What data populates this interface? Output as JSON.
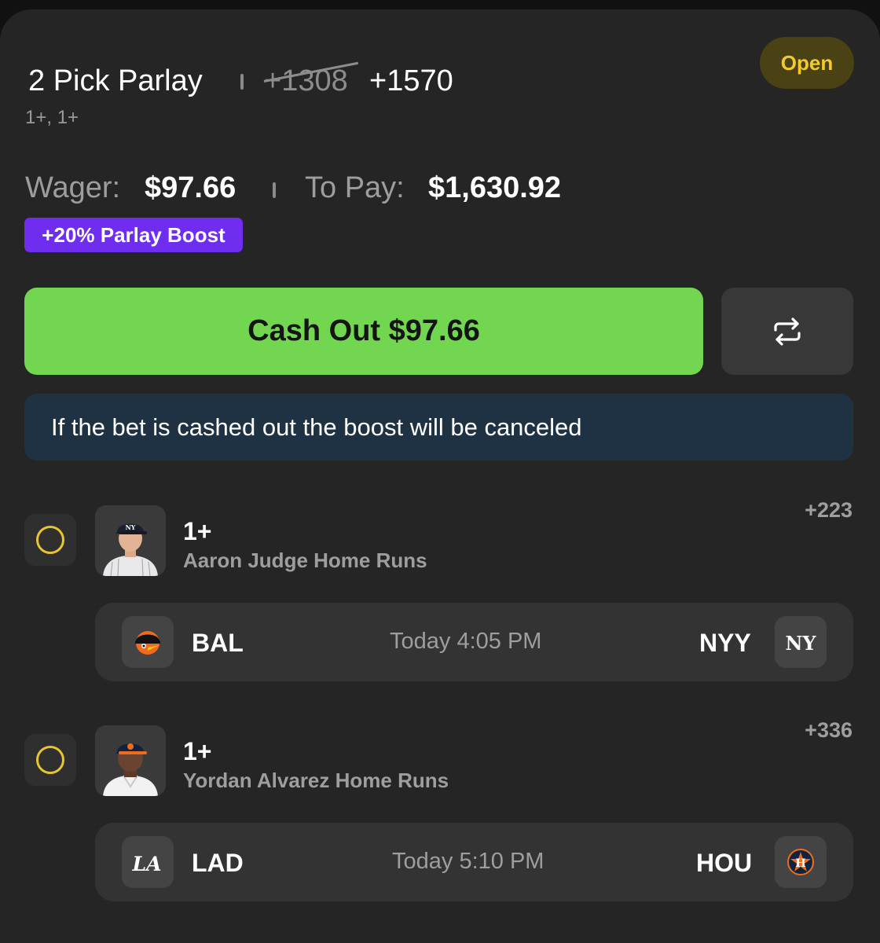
{
  "bet": {
    "title": "2 Pick Parlay",
    "original_odds": "+1308",
    "boosted_odds": "+1570",
    "subtitle": "1+, 1+",
    "status": "Open",
    "wager_label": "Wager:",
    "wager_value": "$97.66",
    "to_pay_label": "To Pay:",
    "to_pay_value": "$1,630.92",
    "boost_label": "+20% Parlay Boost",
    "cashout_label": "Cash Out $97.66",
    "notice": "If the bet is cashed out the boost will be canceled"
  },
  "picks": [
    {
      "line": "1+",
      "market": "Aaron Judge Home Runs",
      "odds": "+223",
      "headshot_icon": "aaron-judge-headshot",
      "game": {
        "away": "BAL",
        "home": "NYY",
        "time": "Today 4:05 PM",
        "away_logo_icon": "orioles-logo",
        "home_logo_icon": "yankees-logo"
      }
    },
    {
      "line": "1+",
      "market": "Yordan Alvarez Home Runs",
      "odds": "+336",
      "headshot_icon": "yordan-alvarez-headshot",
      "game": {
        "away": "LAD",
        "home": "HOU",
        "time": "Today 5:10 PM",
        "away_logo_icon": "dodgers-logo",
        "home_logo_icon": "astros-logo"
      }
    }
  ],
  "colors": {
    "card_bg": "#252525",
    "accent_green": "#72d651",
    "open_badge_text": "#f1cb2b",
    "boost_purple": "#6f2df0",
    "notice_bg": "#1f3244",
    "radio_ring": "#e6c531"
  }
}
